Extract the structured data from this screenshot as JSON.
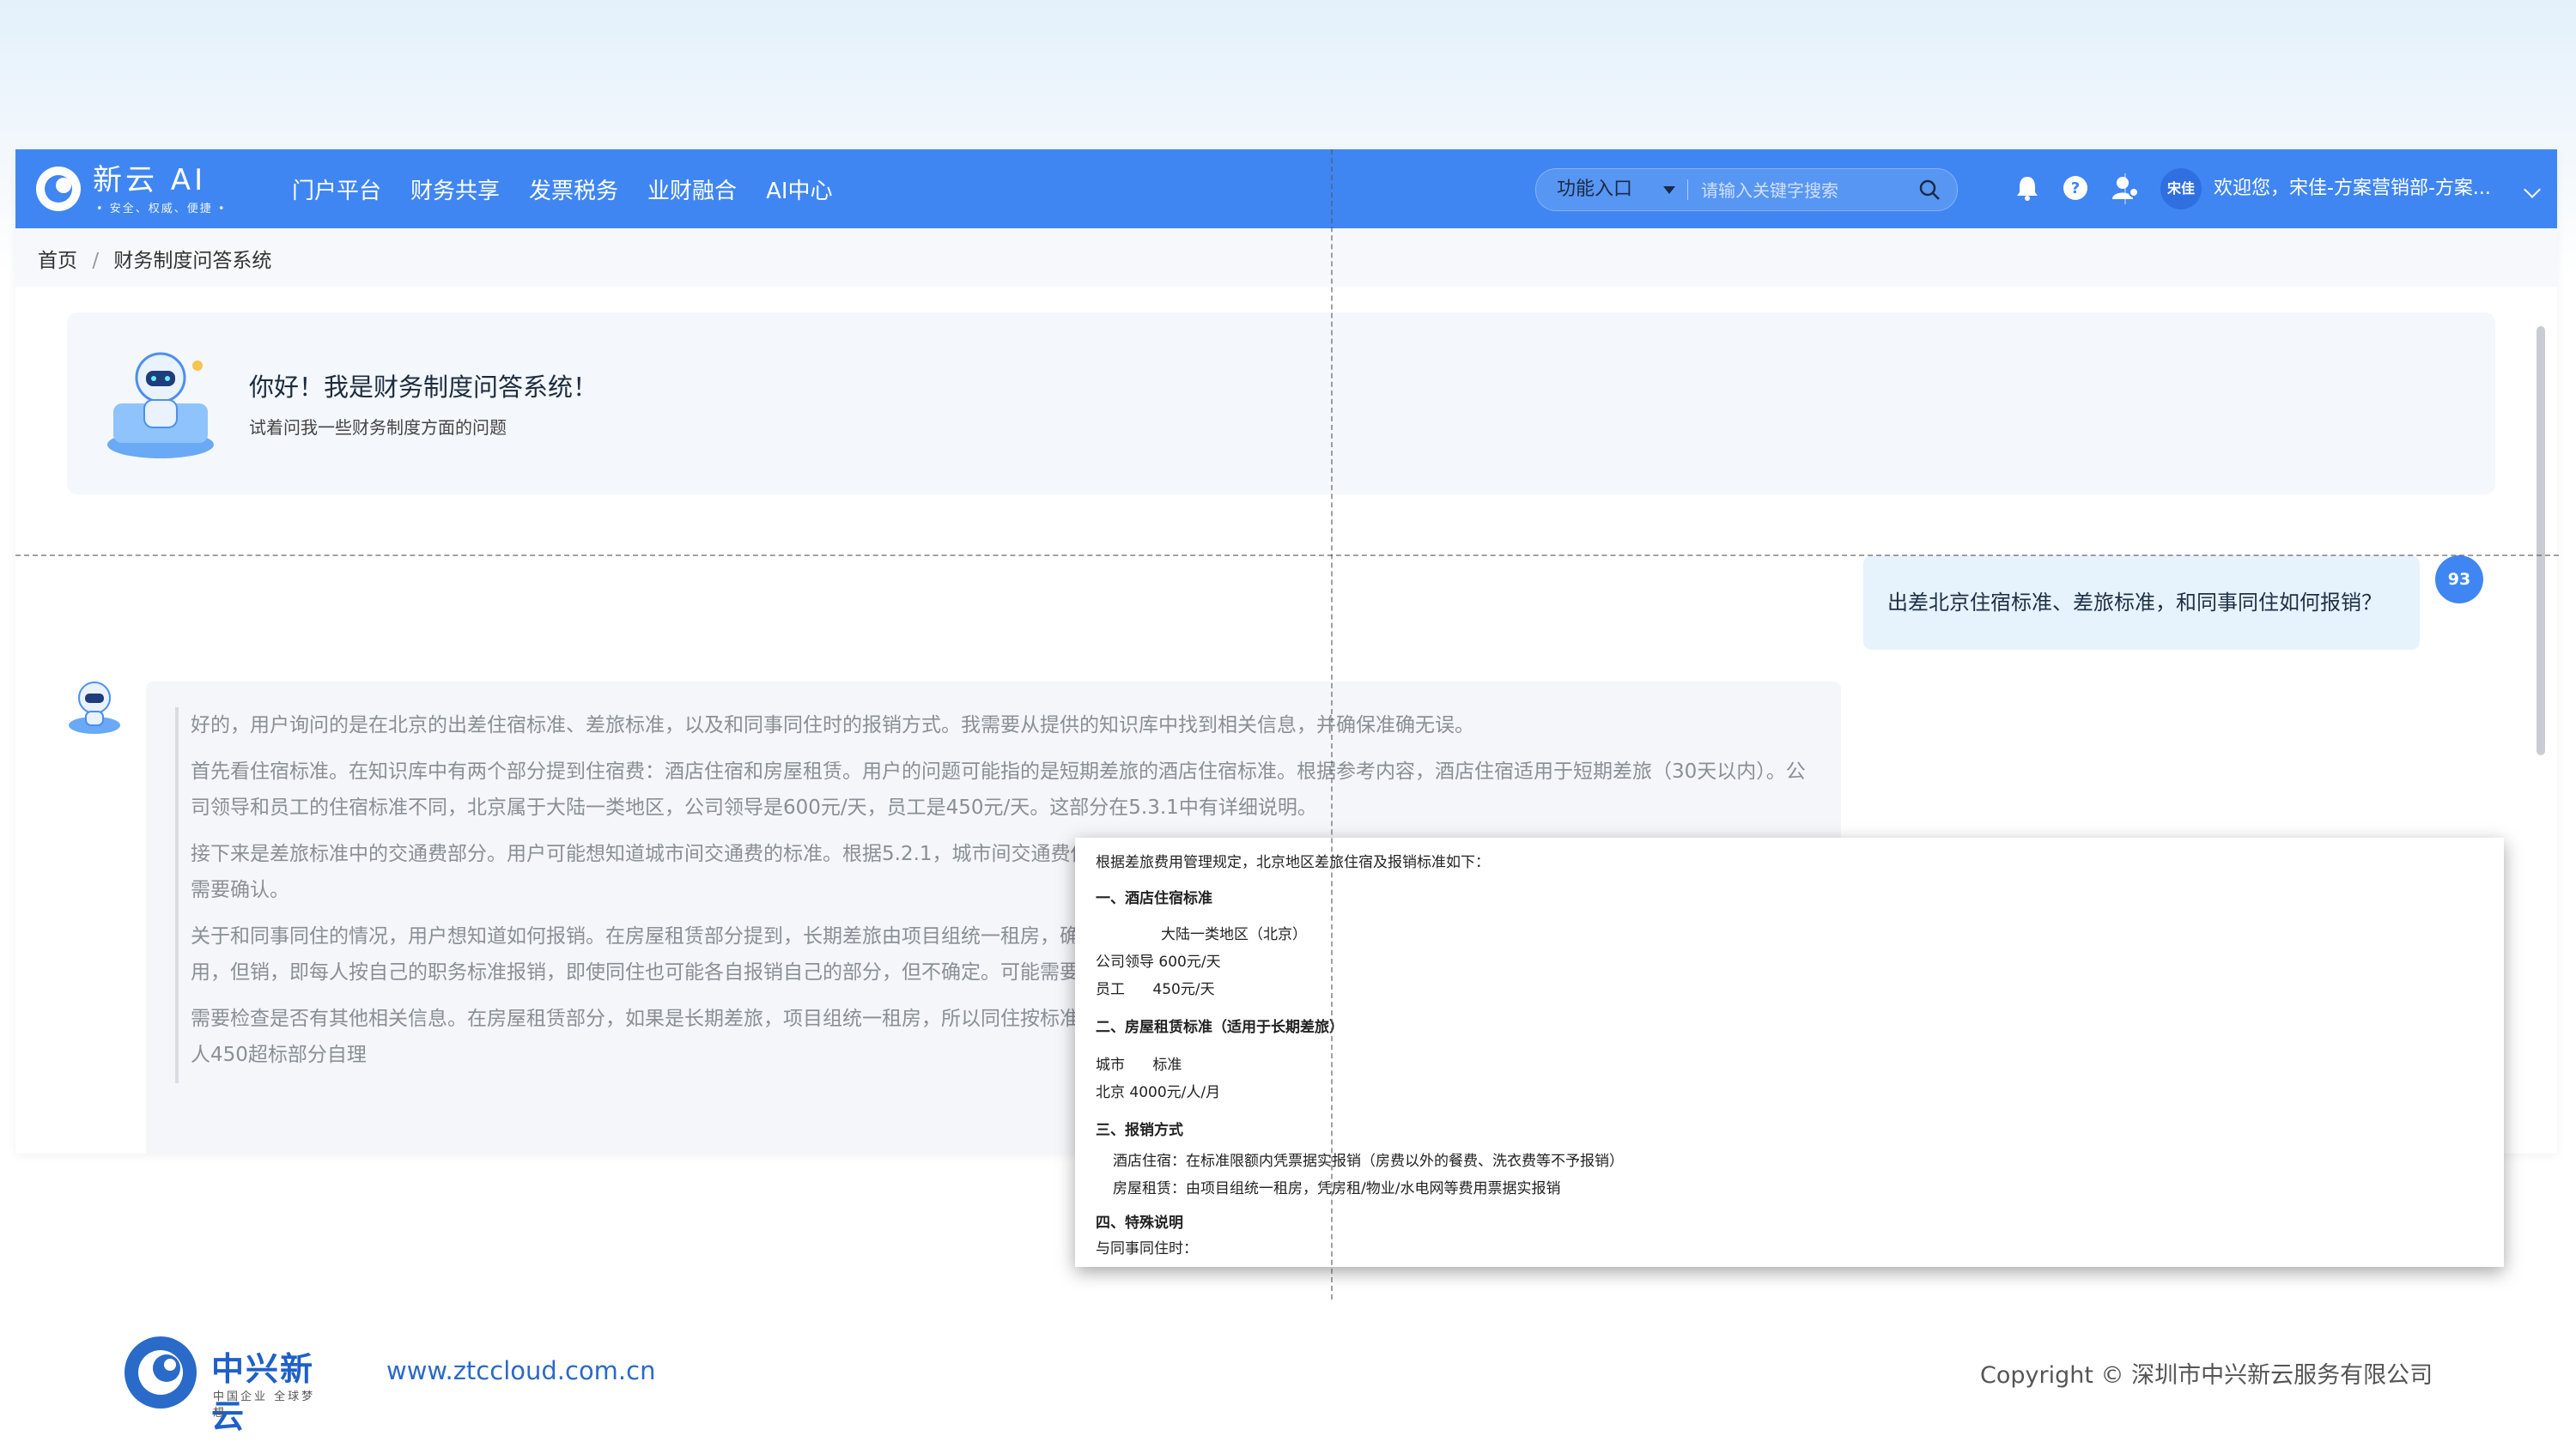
{
  "app": {
    "logo_name": "新云 AI",
    "logo_slogan": "• 安全、权威、便捷 •",
    "nav": [
      "门户平台",
      "财务共享",
      "发票税务",
      "业财融合",
      "AI中心"
    ],
    "func_select": "功能入口",
    "search_placeholder": "请输入关键字搜索",
    "avatar_label": "宋佳",
    "welcome_text": "欢迎您，宋佳-方案营销部-方案...",
    "icons": [
      "bell-icon",
      "help-icon",
      "user-icon",
      "search-icon"
    ]
  },
  "breadcrumb": [
    "首页",
    "/",
    "财务制度问答系统"
  ],
  "welcome_card": {
    "title": "你好！我是财务制度问答系统！",
    "subtitle": "试着问我一些财务制度方面的问题"
  },
  "user_message": {
    "avatar": "93",
    "text": "出差北京住宿标准、差旅标准，和同事同住如何报销？"
  },
  "answer_paragraphs": [
    "好的，用户询问的是在北京的出差住宿标准、差旅标准，以及和同事同住时的报销方式。我需要从提供的知识库中找到相关信息，并确保准确无误。",
    "首先看住宿标准。在知识库中有两个部分提到住宿费：酒店住宿和房屋租赁。用户的问题可能指的是短期差旅的酒店住宿标准。根据参考内容，酒店住宿适用于短期差旅（30天以内）。公司领导和员工的住宿标准不同，北京属于大陆一类地区，公司领导是600元/天，员工是450元/天。这部分在5.3.1中有详细说明。",
    "接下来是差旅标准中的交通费部分。用户可能想知道城市间交通费的标准。根据5.2.1，城市间交通费低于二等座价格。这部分可能需要提到，但用户主要问住宿，所以可能不需要深入，但需要确认。",
    "关于和同事同住的情况，用户想知道如何报销。在房屋租赁部分提到，长期差旅由项目组统一租房，确说明同住的情况如何处理。可能需要推断，比如如果是短期差旅，同住的话是否摊费用，但销，即每人按自己的职务标准报销，即使同住也可能各自报销自己的部分，但不确定。可能需要咨询财务部门。",
    "需要检查是否有其他相关信息。在房屋租赁部分，如果是长期差旅，项目组统一租房，所以同住按标准报销，即使同住，每个人的额度不变。例如，两个员工同住一间房，费用900元，每人450超标部分自理"
  ],
  "overlay": {
    "lines": [
      "根据差旅费用管理规定，北京地区差旅住宿及报销标准如下：",
      "一、酒店住宿标准",
      "大陆一类地区（北京）",
      "公司领导 600元/天",
      "员工      450元/天",
      "二、房屋租赁标准（适用于长期差旅）",
      "城市      标准",
      "北京 4000元/人/月",
      "三、报销方式",
      "酒店住宿：在标准限额内凭票据实报销（房费以外的餐费、洗衣费等不予报销）",
      "房屋租赁：由项目组统一租房，凭房租/物业/水电网等费用票据实报销",
      "四、特殊说明",
      "与同事同住时："
    ]
  },
  "footer": {
    "logo_name": "中兴新云",
    "logo_slogan": "中国企业 全球梦想",
    "url": "www.ztccloud.com.cn",
    "copyright": "Copyright © 深圳市中兴新云服务有限公司"
  },
  "colors": {
    "brand": "#3f86f3",
    "bubble": "#e6f3fd",
    "answer_bg": "#f4f6f9"
  }
}
